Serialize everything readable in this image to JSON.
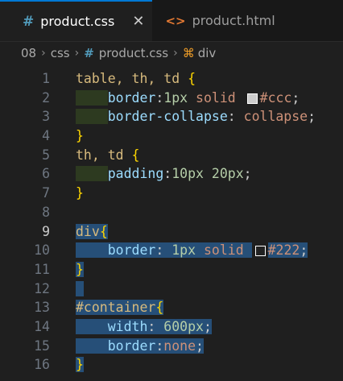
{
  "tabs": [
    {
      "label": "product.css",
      "icon": "#",
      "active": true
    },
    {
      "label": "product.html",
      "icon": "<>",
      "active": false
    }
  ],
  "breadcrumb": [
    "08",
    "css",
    "product.css",
    "div"
  ],
  "lines": [
    {
      "n": "1",
      "parts": [
        [
          "sel",
          "table, th, td "
        ],
        [
          "brace2",
          "{"
        ]
      ]
    },
    {
      "n": "2",
      "parts": [
        [
          "ind",
          "    "
        ],
        [
          "prop",
          "border"
        ],
        [
          "pun",
          ":"
        ],
        [
          "num",
          "1px"
        ],
        [
          "val",
          " solid "
        ],
        [
          "sw",
          "#cccccc"
        ],
        [
          "val",
          "#ccc"
        ],
        [
          "pun",
          ";"
        ]
      ]
    },
    {
      "n": "3",
      "parts": [
        [
          "ind",
          "    "
        ],
        [
          "prop",
          "border-collapse"
        ],
        [
          "pun",
          ": "
        ],
        [
          "val",
          "collapse"
        ],
        [
          "pun",
          ";"
        ]
      ]
    },
    {
      "n": "4",
      "parts": [
        [
          "brace2",
          "}"
        ]
      ]
    },
    {
      "n": "5",
      "parts": [
        [
          "sel",
          "th, td "
        ],
        [
          "brace2",
          "{"
        ]
      ]
    },
    {
      "n": "6",
      "parts": [
        [
          "ind",
          "    "
        ],
        [
          "prop",
          "padding"
        ],
        [
          "pun",
          ":"
        ],
        [
          "num",
          "10px 20px"
        ],
        [
          "pun",
          ";"
        ]
      ]
    },
    {
      "n": "7",
      "parts": [
        [
          "brace2",
          "}"
        ]
      ]
    },
    {
      "n": "8",
      "parts": []
    },
    {
      "n": "9",
      "parts": [
        [
          "sel",
          "div"
        ],
        [
          "brace2",
          "{"
        ]
      ],
      "selected": true,
      "current": true
    },
    {
      "n": "10",
      "parts": [
        [
          "ind",
          "    "
        ],
        [
          "prop",
          "border"
        ],
        [
          "pun",
          ": "
        ],
        [
          "num",
          "1px"
        ],
        [
          "val",
          " solid "
        ],
        [
          "sw",
          "#222222"
        ],
        [
          "val",
          "#222"
        ],
        [
          "pun",
          ";"
        ]
      ],
      "selected": true
    },
    {
      "n": "11",
      "parts": [
        [
          "brace2",
          "}"
        ]
      ],
      "selected": true
    },
    {
      "n": "12",
      "parts": [],
      "selected": true
    },
    {
      "n": "13",
      "parts": [
        [
          "sel",
          "#container"
        ],
        [
          "brace2",
          "{"
        ]
      ],
      "selected": true
    },
    {
      "n": "14",
      "parts": [
        [
          "ind",
          "    "
        ],
        [
          "prop",
          "width"
        ],
        [
          "pun",
          ": "
        ],
        [
          "num",
          "600px"
        ],
        [
          "pun",
          ";"
        ]
      ],
      "selected": true
    },
    {
      "n": "15",
      "parts": [
        [
          "ind",
          "    "
        ],
        [
          "prop",
          "border"
        ],
        [
          "pun",
          ":"
        ],
        [
          "val",
          "none"
        ],
        [
          "pun",
          ";"
        ]
      ],
      "selected": true
    },
    {
      "n": "16",
      "parts": [
        [
          "brace2",
          "}"
        ]
      ],
      "selected": true
    }
  ]
}
